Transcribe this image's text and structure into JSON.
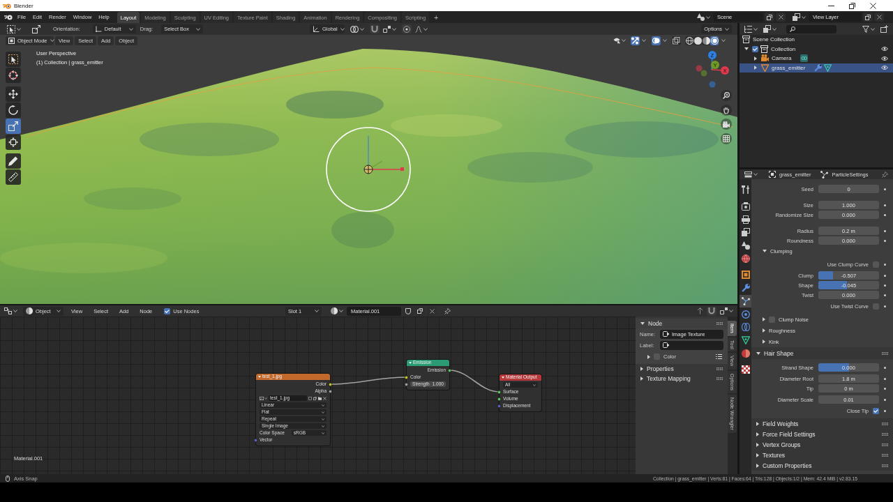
{
  "window": {
    "title": "Blender"
  },
  "menu": [
    "File",
    "Edit",
    "Render",
    "Window",
    "Help"
  ],
  "workspaces": [
    {
      "label": "Layout",
      "selected": true
    },
    {
      "label": "Modeling",
      "selected": false
    },
    {
      "label": "Sculpting",
      "selected": false
    },
    {
      "label": "UV Editing",
      "selected": false
    },
    {
      "label": "Texture Paint",
      "selected": false
    },
    {
      "label": "Shading",
      "selected": false
    },
    {
      "label": "Animation",
      "selected": false
    },
    {
      "label": "Rendering",
      "selected": false
    },
    {
      "label": "Compositing",
      "selected": false
    },
    {
      "label": "Scripting",
      "selected": false
    }
  ],
  "add_workspace": "+",
  "scene": "Scene",
  "view_layer": "View Layer",
  "viewport": {
    "tool_settings": {
      "orientation_label": "Orientation:",
      "orientation": "Default",
      "drag_label": "Drag:",
      "drag": "Select Box",
      "transform_orientation": "Global",
      "options": "Options"
    },
    "header": {
      "mode": "Object Mode",
      "menus": [
        "View",
        "Select",
        "Add",
        "Object"
      ],
      "toggles": [
        {
          "kind": "gizmos",
          "on": true
        },
        {
          "kind": "overlays",
          "on": true
        },
        {
          "kind": "xray",
          "on": false
        }
      ],
      "shading": [
        {
          "kind": "wireframe",
          "selected": false
        },
        {
          "kind": "solid",
          "selected": false
        },
        {
          "kind": "material",
          "selected": false
        },
        {
          "kind": "rendered",
          "selected": true
        }
      ]
    },
    "info": [
      "User Perspective",
      "(1) Collection | grass_emitter"
    ],
    "tools": [
      {
        "kind": "select_box",
        "selected": false
      },
      {
        "kind": "cursor",
        "selected": false
      },
      {
        "kind": "move",
        "selected": false
      },
      {
        "kind": "rotate",
        "selected": false
      },
      {
        "kind": "scale",
        "selected": true
      },
      {
        "kind": "transform",
        "selected": false
      },
      {
        "kind": "annotate",
        "selected": false
      },
      {
        "kind": "measure",
        "selected": false
      }
    ],
    "axes": [
      {
        "label": "Z",
        "color": "#2f7fe0"
      },
      {
        "label": "Y",
        "color": "#6f9a24"
      },
      {
        "label": "X",
        "color": "#e0394c"
      }
    ]
  },
  "node_editor": {
    "header": {
      "object": "Object",
      "menus": [
        "View",
        "Select",
        "Add",
        "Node"
      ],
      "use_nodes": {
        "label": "Use Nodes",
        "checked": true
      },
      "slot": "Slot 1",
      "material": "Material.001"
    },
    "material_name": "Material.001",
    "nodes": [
      {
        "kind": "image_texture",
        "title": "test_1.jpg",
        "outputs": [
          {
            "label": "Color",
            "kind": "color",
            "connected": true
          },
          {
            "label": "Alpha",
            "kind": "float",
            "connected": false
          }
        ],
        "image": "test_1.jpg",
        "options": [
          "Linear",
          "Flat",
          "Repeat",
          "Single Image"
        ],
        "color_space": {
          "label": "Color Space",
          "value": "sRGB"
        },
        "inputs": [
          {
            "label": "Vector",
            "kind": "vector",
            "connected": false
          }
        ]
      },
      {
        "kind": "emission",
        "title": "Emission",
        "outputs": [
          {
            "label": "Emission",
            "kind": "shader",
            "connected": true
          }
        ],
        "inputs": [
          {
            "label": "Color",
            "kind": "color",
            "connected": true
          },
          {
            "label": "Strength",
            "value": "1.000",
            "kind": "float",
            "connected": false
          }
        ]
      },
      {
        "kind": "output",
        "title": "Material Output",
        "target": "All",
        "inputs": [
          {
            "label": "Surface",
            "kind": "shader",
            "connected": true
          },
          {
            "label": "Volume",
            "kind": "shader",
            "connected": false
          },
          {
            "label": "Displacement",
            "kind": "vector",
            "connected": false
          }
        ]
      }
    ],
    "sidebar": {
      "panels": [
        {
          "title": "Node",
          "expanded": true,
          "fields": [
            {
              "label": "Name:",
              "value": "Image Texture"
            },
            {
              "label": "Label:"
            }
          ],
          "subpanels": [
            {
              "title": "Color",
              "expanded": false,
              "checked": false
            }
          ]
        },
        {
          "title": "Properties",
          "expanded": false
        },
        {
          "title": "Texture Mapping",
          "expanded": false
        }
      ],
      "tabs": [
        {
          "label": "Item",
          "selected": true
        },
        {
          "label": "Tool",
          "selected": false
        },
        {
          "label": "View",
          "selected": false
        },
        {
          "label": "Options",
          "selected": false
        },
        {
          "label": "Node Wrangler",
          "selected": false
        }
      ]
    }
  },
  "outliner": {
    "tree": [
      {
        "label": "Scene Collection",
        "kind": "scene_collection",
        "selected": false,
        "children": [
          {
            "label": "Collection",
            "kind": "collection",
            "expanded": true,
            "checked": true,
            "visible": true,
            "selected": false,
            "children": [
              {
                "label": "Camera",
                "kind": "camera",
                "expanded": false,
                "visible": true,
                "selected": false,
                "badges": [
                  {
                    "kind": "camera_data"
                  }
                ]
              },
              {
                "label": "grass_emitter",
                "kind": "mesh",
                "expanded": false,
                "visible": true,
                "selected": true,
                "badges": [
                  {
                    "kind": "modifier"
                  },
                  {
                    "kind": "particles"
                  }
                ]
              }
            ]
          }
        ]
      }
    ]
  },
  "properties": {
    "object": "grass_emitter",
    "data_block": "ParticleSettings",
    "tabs": [
      {
        "kind": "tool",
        "selected": false
      },
      {
        "kind": "render",
        "selected": false
      },
      {
        "kind": "output",
        "selected": false
      },
      {
        "kind": "view_layer",
        "selected": false
      },
      {
        "kind": "scene",
        "selected": false
      },
      {
        "kind": "world",
        "selected": false
      },
      {
        "kind": "object",
        "selected": false
      },
      {
        "kind": "modifiers",
        "selected": false
      },
      {
        "kind": "particles",
        "selected": true
      },
      {
        "kind": "physics",
        "selected": false
      },
      {
        "kind": "constraints",
        "selected": false
      },
      {
        "kind": "data",
        "selected": false
      },
      {
        "kind": "material",
        "selected": false
      },
      {
        "kind": "texture",
        "selected": false
      }
    ],
    "sections": [
      {
        "kind": "fields",
        "groups": [
          [
            {
              "kind": "number",
              "label": "Seed",
              "value": "0"
            }
          ],
          [
            {
              "kind": "number",
              "label": "Size",
              "value": "1.000"
            },
            {
              "kind": "number",
              "label": "Randomize Size",
              "value": "0.000"
            }
          ],
          [
            {
              "kind": "number",
              "label": "Radius",
              "value": "0.2 m"
            },
            {
              "kind": "number",
              "label": "Roundness",
              "value": "0.000"
            }
          ]
        ]
      },
      {
        "kind": "subpanel",
        "title": "Clumping",
        "expanded": true,
        "groups": [
          [
            {
              "kind": "checkbox",
              "label": "Use Clump Curve",
              "checked": false
            }
          ],
          [
            {
              "kind": "slider",
              "label": "Clump",
              "value": "-0.507",
              "level": 0.24
            },
            {
              "kind": "slider",
              "label": "Shape",
              "value": "-0.045",
              "level": 0.47
            },
            {
              "kind": "number",
              "label": "Twist",
              "value": "0.000"
            }
          ],
          [
            {
              "kind": "checkbox",
              "label": "Use Twist Curve",
              "checked": false
            }
          ]
        ]
      },
      {
        "kind": "subpanel_toggle",
        "title": "Clump Noise",
        "expanded": false,
        "checked": false
      },
      {
        "kind": "subpanel",
        "title": "Roughness",
        "expanded": false
      },
      {
        "kind": "subpanel",
        "title": "Kink",
        "expanded": false
      },
      {
        "kind": "panel",
        "title": "Hair Shape",
        "expanded": true,
        "groups": [
          [
            {
              "kind": "slider",
              "label": "Strand Shape",
              "value": "0.000",
              "level": 0.5
            }
          ],
          [
            {
              "kind": "number",
              "label": "Diameter Root",
              "value": "1.8 m"
            },
            {
              "kind": "number",
              "label": "Tip",
              "value": "0 m"
            }
          ],
          [
            {
              "kind": "number",
              "label": "Diameter Scale",
              "value": "0.01"
            }
          ],
          [
            {
              "kind": "checkbox",
              "label": "Close Tip",
              "checked": true
            }
          ]
        ]
      },
      {
        "kind": "panel",
        "title": "Field Weights",
        "expanded": false
      },
      {
        "kind": "panel",
        "title": "Force Field Settings",
        "expanded": false
      },
      {
        "kind": "panel",
        "title": "Vertex Groups",
        "expanded": false
      },
      {
        "kind": "panel",
        "title": "Textures",
        "expanded": false
      },
      {
        "kind": "panel",
        "title": "Custom Properties",
        "expanded": false
      }
    ]
  },
  "status_bar": {
    "hint": "Axis Snap",
    "stats": "Collection | grass_emitter | Verts:81 | Faces:64 | Tris:128 | Objects:1/2 | Mem: 42.4 MiB | v2.83.15"
  }
}
